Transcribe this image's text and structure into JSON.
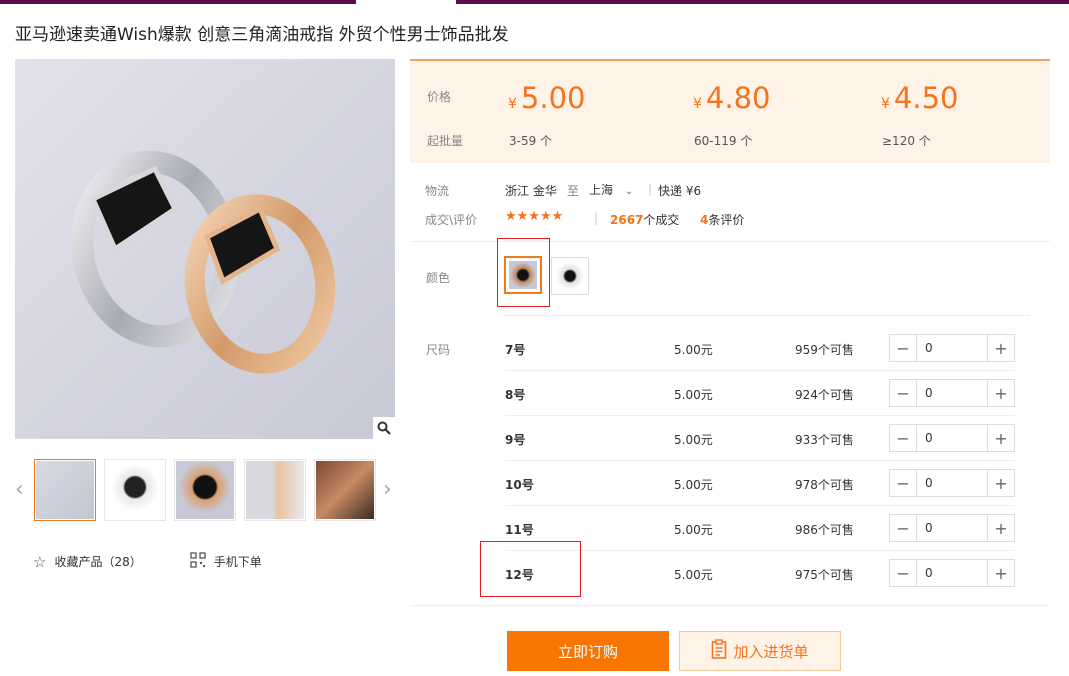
{
  "title": "亚马逊速卖通Wish爆款 创意三角滴油戒指 外贸个性男士饰品批发",
  "pricing": {
    "price_label": "价格",
    "moq_label": "起批量",
    "currency": "¥",
    "tiers": [
      {
        "price": "5.00",
        "range": "3-59 个"
      },
      {
        "price": "4.80",
        "range": "60-119 个"
      },
      {
        "price": "4.50",
        "range": "≥120 个"
      }
    ]
  },
  "logistics": {
    "label": "物流",
    "from": "浙江 金华",
    "to_word": "至",
    "to": "上海",
    "express": "快递 ¥6"
  },
  "deals": {
    "label": "成交\\评价",
    "stars": "★★★★★",
    "deal_count": "2667",
    "deal_suffix": "个成交",
    "review_count": "4",
    "review_suffix": "条评价"
  },
  "color": {
    "label": "颜色"
  },
  "size": {
    "label": "尺码",
    "rows": [
      {
        "size": "7号",
        "price": "5.00元",
        "stock": "959个可售",
        "qty": "0"
      },
      {
        "size": "8号",
        "price": "5.00元",
        "stock": "924个可售",
        "qty": "0"
      },
      {
        "size": "9号",
        "price": "5.00元",
        "stock": "933个可售",
        "qty": "0"
      },
      {
        "size": "10号",
        "price": "5.00元",
        "stock": "978个可售",
        "qty": "0"
      },
      {
        "size": "11号",
        "price": "5.00元",
        "stock": "986个可售",
        "qty": "0"
      },
      {
        "size": "12号",
        "price": "5.00元",
        "stock": "975个可售",
        "qty": "0"
      }
    ]
  },
  "actions": {
    "favorite": "收藏产品（28）",
    "mobile": "手机下单"
  },
  "buttons": {
    "buy": "立即订购",
    "cart": "加入进货单"
  },
  "colors": {
    "accent": "#f77500",
    "price": "#f6731c",
    "highlight": "#e02020",
    "topbar": "#5b0c4a"
  }
}
